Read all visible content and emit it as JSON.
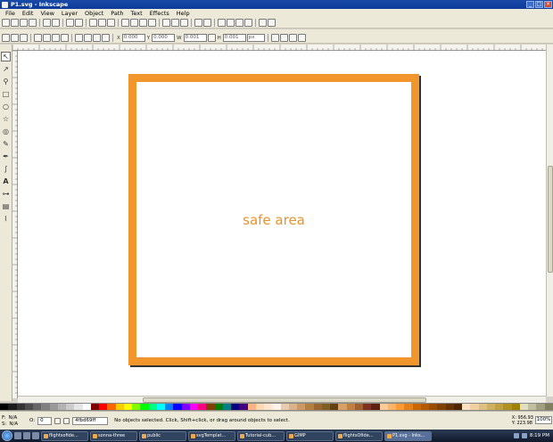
{
  "window": {
    "title": "P1.svg - Inkscape"
  },
  "menu": [
    "File",
    "Edit",
    "View",
    "Layer",
    "Object",
    "Path",
    "Text",
    "Effects",
    "Help"
  ],
  "toolbar2": {
    "x_value": "0.000",
    "y_value": "0.000",
    "w_value": "0.001",
    "h_value": "0.001",
    "unit": "px"
  },
  "canvas": {
    "text": "safe area",
    "frame_color": "#f0962d",
    "text_color": "#e8932a"
  },
  "status": {
    "fill_label": "F:",
    "fill_value": "N/A",
    "stroke_label": "S:",
    "stroke_value": "N/A",
    "opacity_label": "O:",
    "opacity_value": "0",
    "layer_color": "4fbd69ff",
    "message": "No objects selected. Click, Shift+click, or drag around objects to select.",
    "x_coord": "X: 956.93",
    "y_coord": "Y: 223.98",
    "zoom": "100%"
  },
  "taskbar": {
    "items": [
      "flightsofide...",
      "sonna-three",
      "public",
      "svgTemplat...",
      "Tutorial-cub...",
      "GIMP",
      "flightsOfide...",
      "P1.svg - Inks..."
    ],
    "active_index": 7,
    "clock": "8:19 PM"
  },
  "palette": [
    "#000000",
    "#1a1a1a",
    "#333333",
    "#4d4d4d",
    "#666666",
    "#808080",
    "#999999",
    "#b3b3b3",
    "#cccccc",
    "#e6e6e6",
    "#ffffff",
    "#800000",
    "#ff0000",
    "#ff6600",
    "#ffcc00",
    "#ffff00",
    "#80ff00",
    "#00ff00",
    "#00ff80",
    "#00ffff",
    "#0080ff",
    "#0000ff",
    "#8000ff",
    "#ff00ff",
    "#ff0080",
    "#804000",
    "#008000",
    "#008080",
    "#000080",
    "#400080",
    "#ffb380",
    "#ffd9b3",
    "#ffe6cc",
    "#fff2e6",
    "#e6ccb3",
    "#d9b38c",
    "#cc9966",
    "#b38040",
    "#996633",
    "#806020",
    "#664010",
    "#d9a066",
    "#c08040",
    "#a06030",
    "#803020",
    "#602010",
    "#ffcc99",
    "#ffb366",
    "#ff9933",
    "#e68019",
    "#cc6600",
    "#b35900",
    "#994d00",
    "#804000",
    "#663300",
    "#4d2600",
    "#ffe0c0",
    "#f0d0a0",
    "#e0c080",
    "#d0b060",
    "#c0a040",
    "#b09020",
    "#a08000",
    "#e0e0c0",
    "#c0c0a0",
    "#a0a080",
    "#808060"
  ]
}
